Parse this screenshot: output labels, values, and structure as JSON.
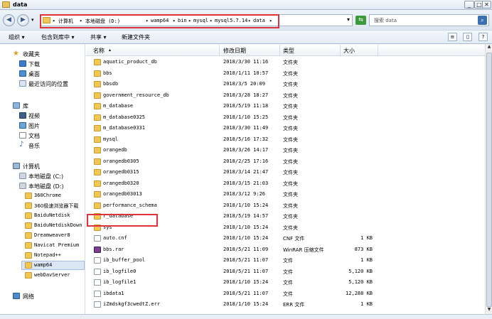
{
  "window": {
    "title": "data"
  },
  "address": {
    "crumbs": [
      "计算机",
      "本地磁盘 (D:)",
      "wamp64",
      "bin",
      "mysql",
      "mysql5.7.14",
      "data"
    ],
    "search_placeholder": "搜索 data"
  },
  "toolbar": {
    "organize": "组织 ▾",
    "include": "包含到库中 ▾",
    "share": "共享 ▾",
    "new_folder": "新建文件夹"
  },
  "nav": {
    "favorites": "收藏夹",
    "fav_items": [
      "下载",
      "桌面",
      "最近访问的位置"
    ],
    "libraries": "库",
    "lib_items": [
      "视频",
      "图片",
      "文档",
      "音乐"
    ],
    "computer": "计算机",
    "drives": [
      "本地磁盘 (C:)",
      "本地磁盘 (D:)"
    ],
    "d_folders": [
      "360Chrome",
      "360极速浏览器下载",
      "BaiduNetdisk",
      "BaiduNetdiskDown",
      "Dreamweaver8",
      "Navicat Premium",
      "Notepad++",
      "wamp64",
      "webDavServer"
    ],
    "network": "网络"
  },
  "columns": {
    "name": "名称",
    "date": "修改日期",
    "type": "类型",
    "size": "大小"
  },
  "rows": [
    {
      "name": "aquatic_product_db",
      "date": "2018/3/30 11:16",
      "type": "文件夹",
      "size": "",
      "kind": "folder"
    },
    {
      "name": "bbs",
      "date": "2018/1/11 10:57",
      "type": "文件夹",
      "size": "",
      "kind": "folder"
    },
    {
      "name": "bbsdb",
      "date": "2018/3/5 20:09",
      "type": "文件夹",
      "size": "",
      "kind": "folder"
    },
    {
      "name": "government_resource_db",
      "date": "2018/3/28 18:27",
      "type": "文件夹",
      "size": "",
      "kind": "folder"
    },
    {
      "name": "m_database",
      "date": "2018/5/19 11:18",
      "type": "文件夹",
      "size": "",
      "kind": "folder"
    },
    {
      "name": "m_database0325",
      "date": "2018/1/10 15:25",
      "type": "文件夹",
      "size": "",
      "kind": "folder"
    },
    {
      "name": "m_database0331",
      "date": "2018/3/30 11:49",
      "type": "文件夹",
      "size": "",
      "kind": "folder"
    },
    {
      "name": "mysql",
      "date": "2018/5/16 17:32",
      "type": "文件夹",
      "size": "",
      "kind": "folder"
    },
    {
      "name": "orangedb",
      "date": "2018/3/26 14:17",
      "type": "文件夹",
      "size": "",
      "kind": "folder"
    },
    {
      "name": "orangedb0305",
      "date": "2018/2/25 17:16",
      "type": "文件夹",
      "size": "",
      "kind": "folder"
    },
    {
      "name": "orangedb0315",
      "date": "2018/3/14 21:47",
      "type": "文件夹",
      "size": "",
      "kind": "folder"
    },
    {
      "name": "orangedb0320",
      "date": "2018/3/15 21:03",
      "type": "文件夹",
      "size": "",
      "kind": "folder"
    },
    {
      "name": "orangedb03013",
      "date": "2018/3/12 9:26",
      "type": "文件夹",
      "size": "",
      "kind": "folder"
    },
    {
      "name": "performance_schema",
      "date": "2018/1/10 15:24",
      "type": "文件夹",
      "size": "",
      "kind": "folder"
    },
    {
      "name": "r_database",
      "date": "2018/5/19 14:57",
      "type": "文件夹",
      "size": "",
      "kind": "folder"
    },
    {
      "name": "sys",
      "date": "2018/1/10 15:24",
      "type": "文件夹",
      "size": "",
      "kind": "folder"
    },
    {
      "name": "auto.cnf",
      "date": "2018/1/10 15:24",
      "type": "CNF 文件",
      "size": "1 KB",
      "kind": "file"
    },
    {
      "name": "bbs.rar",
      "date": "2018/5/21 11:09",
      "type": "WinRAR 压缩文件",
      "size": "873 KB",
      "kind": "rar"
    },
    {
      "name": "ib_buffer_pool",
      "date": "2018/5/21 11:07",
      "type": "文件",
      "size": "1 KB",
      "kind": "file"
    },
    {
      "name": "ib_logfile0",
      "date": "2018/5/21 11:07",
      "type": "文件",
      "size": "5,120 KB",
      "kind": "file"
    },
    {
      "name": "ib_logfile1",
      "date": "2018/1/10 15:24",
      "type": "文件",
      "size": "5,120 KB",
      "kind": "file"
    },
    {
      "name": "ibdata1",
      "date": "2018/5/21 11:07",
      "type": "文件",
      "size": "12,288 KB",
      "kind": "file"
    },
    {
      "name": "iZmdskgf3cwedtZ.err",
      "date": "2018/1/10 15:24",
      "type": "ERR 文件",
      "size": "1 KB",
      "kind": "file"
    }
  ]
}
